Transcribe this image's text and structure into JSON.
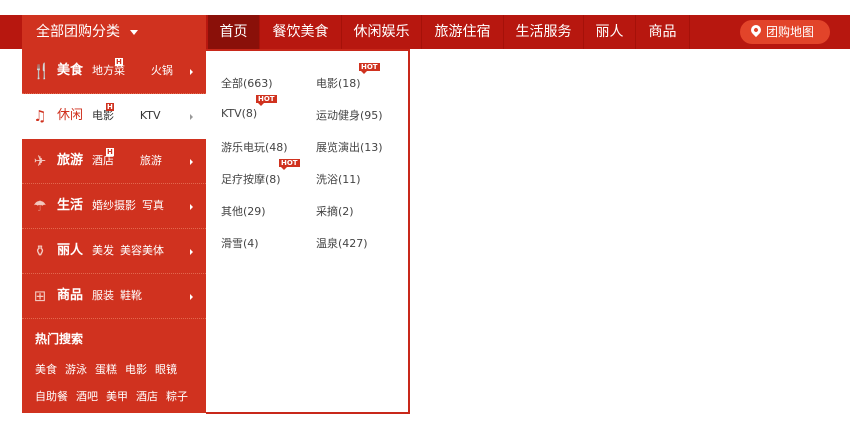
{
  "topnav": {
    "all_categories": "全部团购分类",
    "items": [
      "首页",
      "餐饮美食",
      "休闲娱乐",
      "旅游住宿",
      "生活服务",
      "丽人",
      "商品"
    ],
    "map_button": "团购地图"
  },
  "sidebar": {
    "categories": [
      {
        "name": "美食",
        "subs": [
          "地方菜",
          "火锅"
        ],
        "icon": "fork-knife-icon"
      },
      {
        "name": "休闲",
        "subs": [
          "电影",
          "KTV"
        ],
        "icon": "music-note-icon"
      },
      {
        "name": "旅游",
        "subs": [
          "酒店",
          "旅游"
        ],
        "icon": "airplane-icon"
      },
      {
        "name": "生活",
        "subs": [
          "婚纱摄影",
          "写真"
        ],
        "icon": "umbrella-icon"
      },
      {
        "name": "丽人",
        "subs": [
          "美发",
          "美容美体"
        ],
        "icon": "bottle-icon"
      },
      {
        "name": "商品",
        "subs": [
          "服装",
          "鞋靴"
        ],
        "icon": "basket-icon"
      }
    ],
    "badge": "H",
    "hot_search_title": "热门搜索",
    "hot_search_row1": [
      "美食",
      "游泳",
      "蛋糕",
      "电影",
      "眼镜"
    ],
    "hot_search_row2": [
      "自助餐",
      "酒吧",
      "美甲",
      "酒店",
      "粽子"
    ]
  },
  "panel": {
    "items": [
      {
        "label": "全部(663)"
      },
      {
        "label": "电影(18)",
        "hot": "HOT"
      },
      {
        "label": "KTV(8)",
        "hot": "HOT"
      },
      {
        "label": "运动健身(95)"
      },
      {
        "label": "游乐电玩(48)"
      },
      {
        "label": "展览演出(13)"
      },
      {
        "label": "足疗按摩(8)",
        "hot": "HOT"
      },
      {
        "label": "洗浴(11)"
      },
      {
        "label": "其他(29)"
      },
      {
        "label": "采摘(2)"
      },
      {
        "label": "滑雪(4)"
      },
      {
        "label": "温泉(427)"
      }
    ]
  },
  "colors": {
    "topbar": "#b7170f",
    "sidebar": "#d0321f",
    "accent": "#e2442a"
  }
}
